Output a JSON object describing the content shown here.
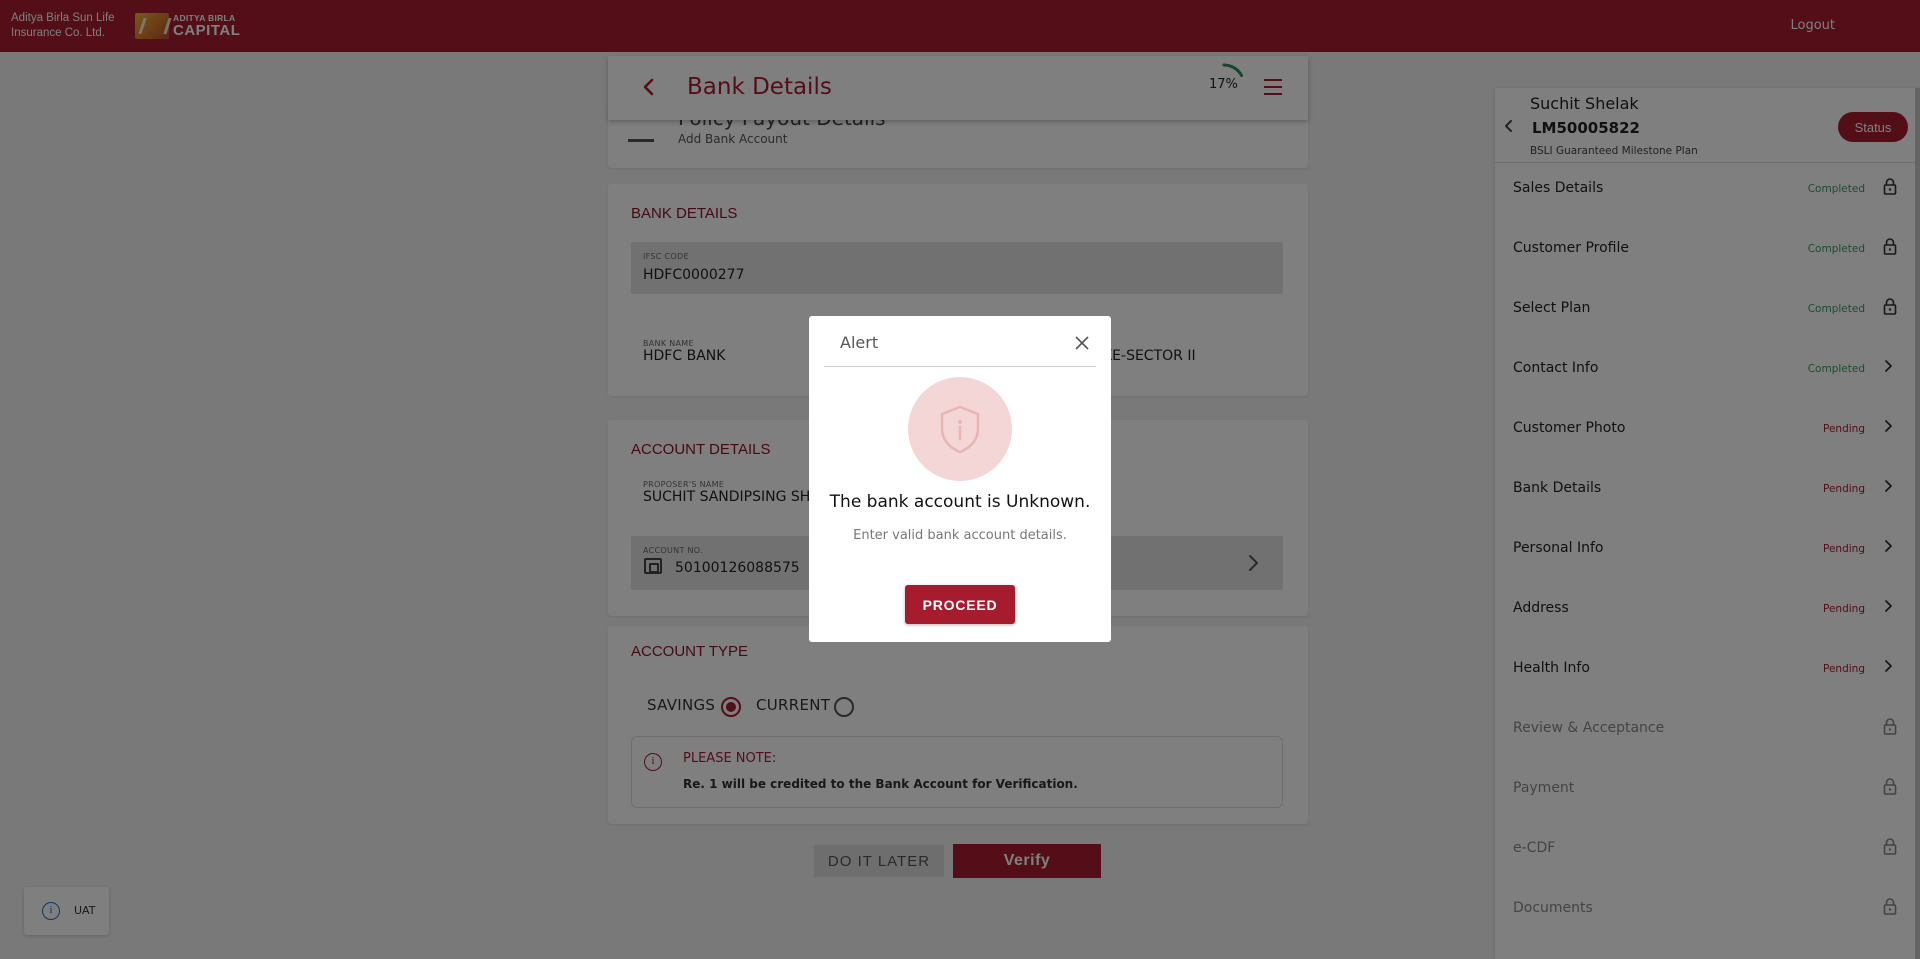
{
  "topbar": {
    "brand_text_line1": "Aditya Birla Sun Life",
    "brand_text_line2": "Insurance Co. Ltd.",
    "logo_small": "ADITYA BIRLA",
    "logo_big": "CAPITAL",
    "logout_label": "Logout"
  },
  "header": {
    "title": "Bank Details",
    "progress_label": "17%",
    "progress_value": 0.17
  },
  "payout": {
    "title": "Policy Payout Details",
    "subtitle": "Add Bank Account"
  },
  "bank_details": {
    "section_title": "BANK DETAILS",
    "ifsc_label": "IFSC CODE",
    "ifsc_value": "HDFC0000277",
    "bank_name_label": "BANK NAME",
    "bank_name_value": "HDFC BANK",
    "branch_value_visible": "KE-SECTOR II"
  },
  "account_details": {
    "section_title": "ACCOUNT DETAILS",
    "proposer_label": "PROPOSER'S NAME",
    "proposer_value": "SUCHIT SANDIPSING SH",
    "account_no_label": "ACCOUNT NO.",
    "account_no_value": "50100126088575"
  },
  "account_type": {
    "section_title": "ACCOUNT TYPE",
    "savings_label": "SAVINGS",
    "current_label": "CURRENT",
    "selected": "SAVINGS",
    "note_title": "PLEASE NOTE:",
    "note_text": "Re. 1 will be credited to the Bank Account for Verification."
  },
  "actions": {
    "later_label": "DO IT LATER",
    "verify_label": "Verify"
  },
  "uat": {
    "label": "UAT"
  },
  "sidebar": {
    "customer_name": "Suchit Shelak",
    "policy_no": "LM50005822",
    "plan_name": "BSLI Guaranteed Milestone Plan",
    "status_button": "Status",
    "steps": [
      {
        "label": "Sales Details",
        "status": "Completed",
        "icon": "lock-icon"
      },
      {
        "label": "Customer Profile",
        "status": "Completed",
        "icon": "lock-icon"
      },
      {
        "label": "Select Plan",
        "status": "Completed",
        "icon": "lock-icon"
      },
      {
        "label": "Contact Info",
        "status": "Completed",
        "icon": "chevron-right-icon"
      },
      {
        "label": "Customer Photo",
        "status": "Pending",
        "icon": "chevron-right-icon"
      },
      {
        "label": "Bank Details",
        "status": "Pending",
        "icon": "chevron-right-icon"
      },
      {
        "label": "Personal Info",
        "status": "Pending",
        "icon": "chevron-right-icon"
      },
      {
        "label": "Address",
        "status": "Pending",
        "icon": "chevron-right-icon"
      },
      {
        "label": "Health Info",
        "status": "Pending",
        "icon": "chevron-right-icon"
      },
      {
        "label": "Review & Acceptance",
        "status": "",
        "icon": "lock-icon"
      },
      {
        "label": "Payment",
        "status": "",
        "icon": "lock-icon"
      },
      {
        "label": "e-CDF",
        "status": "",
        "icon": "lock-icon"
      },
      {
        "label": "Documents",
        "status": "",
        "icon": "lock-icon"
      }
    ]
  },
  "modal": {
    "title": "Alert",
    "message": "The bank account is Unknown.",
    "submessage": "Enter valid bank account details.",
    "button_label": "PROCEED",
    "icon": "shield-info-icon"
  },
  "colors": {
    "brand": "#a61c2e",
    "completed": "#3a9a5a",
    "pending": "#a61c2e"
  }
}
